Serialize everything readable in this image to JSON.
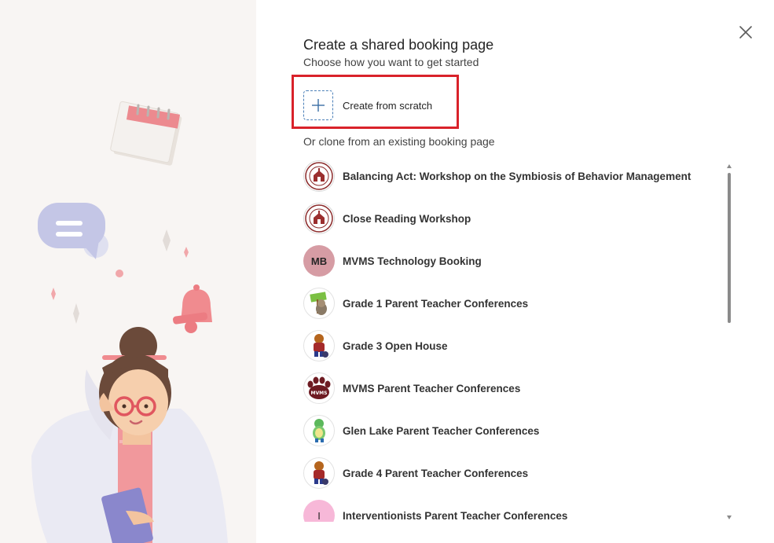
{
  "dialog": {
    "title": "Create a shared booking page",
    "subtitle": "Choose how you want to get started",
    "close_icon": "close-icon"
  },
  "scratch": {
    "label": "Create from scratch",
    "icon": "plus-icon",
    "highlight_color": "#d9222a"
  },
  "clone": {
    "heading": "Or clone from an existing booking page",
    "items": [
      {
        "label": "Balancing Act: Workshop on the Symbiosis of Behavior Management",
        "avatar": "school-seal-icon"
      },
      {
        "label": "Close Reading Workshop",
        "avatar": "school-seal-icon"
      },
      {
        "label": "MVMS Technology Booking",
        "avatar_initials": "MB",
        "avatar_color": "#d69ca4"
      },
      {
        "label": "Grade 1 Parent Teacher Conferences",
        "avatar": "mascot-sign-icon"
      },
      {
        "label": "Grade 3 Open House",
        "avatar": "mascot-icon"
      },
      {
        "label": "MVMS Parent Teacher Conferences",
        "avatar": "paw-icon",
        "avatar_text": "MVMS"
      },
      {
        "label": "Glen Lake Parent Teacher Conferences",
        "avatar": "turtle-icon"
      },
      {
        "label": "Grade 4 Parent Teacher Conferences",
        "avatar": "mascot-icon"
      },
      {
        "label": "Interventionists Parent Teacher Conferences",
        "avatar_initials": "I",
        "avatar_color": "#f7b8d8"
      }
    ]
  },
  "illustration": {
    "elements": [
      "calendar-icon",
      "chat-bubble-icon",
      "bell-icon",
      "sparkle-icon",
      "teacher-illustration"
    ]
  }
}
